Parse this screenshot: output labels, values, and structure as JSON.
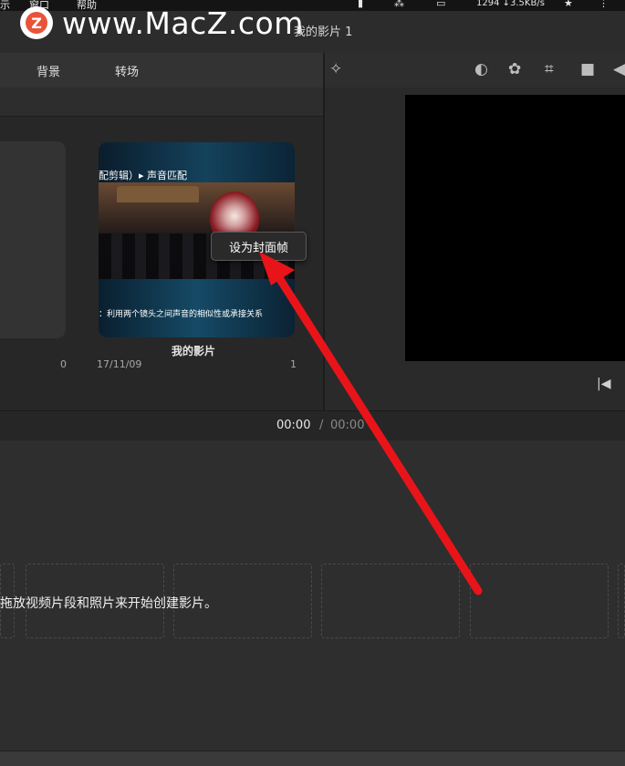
{
  "menubar": {
    "items": [
      "示",
      "窗口",
      "帮助"
    ],
    "network_stats": "1294 ↓3.5KB/s"
  },
  "watermark": {
    "badge": "Z",
    "text": "www.MacZ.com"
  },
  "window": {
    "title": "我的影片 1"
  },
  "tabs": [
    {
      "label": "背景"
    },
    {
      "label": "转场"
    }
  ],
  "browser": {
    "left_card_count": "0",
    "movie": {
      "thumbnail_caption_top": "配剪辑）▸ 声音匹配",
      "thumbnail_caption_bottom": "：利用两个镜头之间声音的相似性或承接关系",
      "title": "我的影片",
      "date": "17/11/09",
      "count": "1"
    },
    "tooltip": "设为封面帧"
  },
  "viewer": {
    "tool_icons": [
      "magic-wand-icon",
      "color-balance-icon",
      "color-correction-icon",
      "crop-icon",
      "stabilization-icon",
      "volume-icon"
    ],
    "preview_color": "#000000"
  },
  "timecode": {
    "current": "00:00",
    "separator": "/",
    "total": "00:00"
  },
  "timeline": {
    "hint": "拖放视频片段和照片来开始创建影片。"
  },
  "annotation": {
    "arrow_color": "#e8141a"
  }
}
